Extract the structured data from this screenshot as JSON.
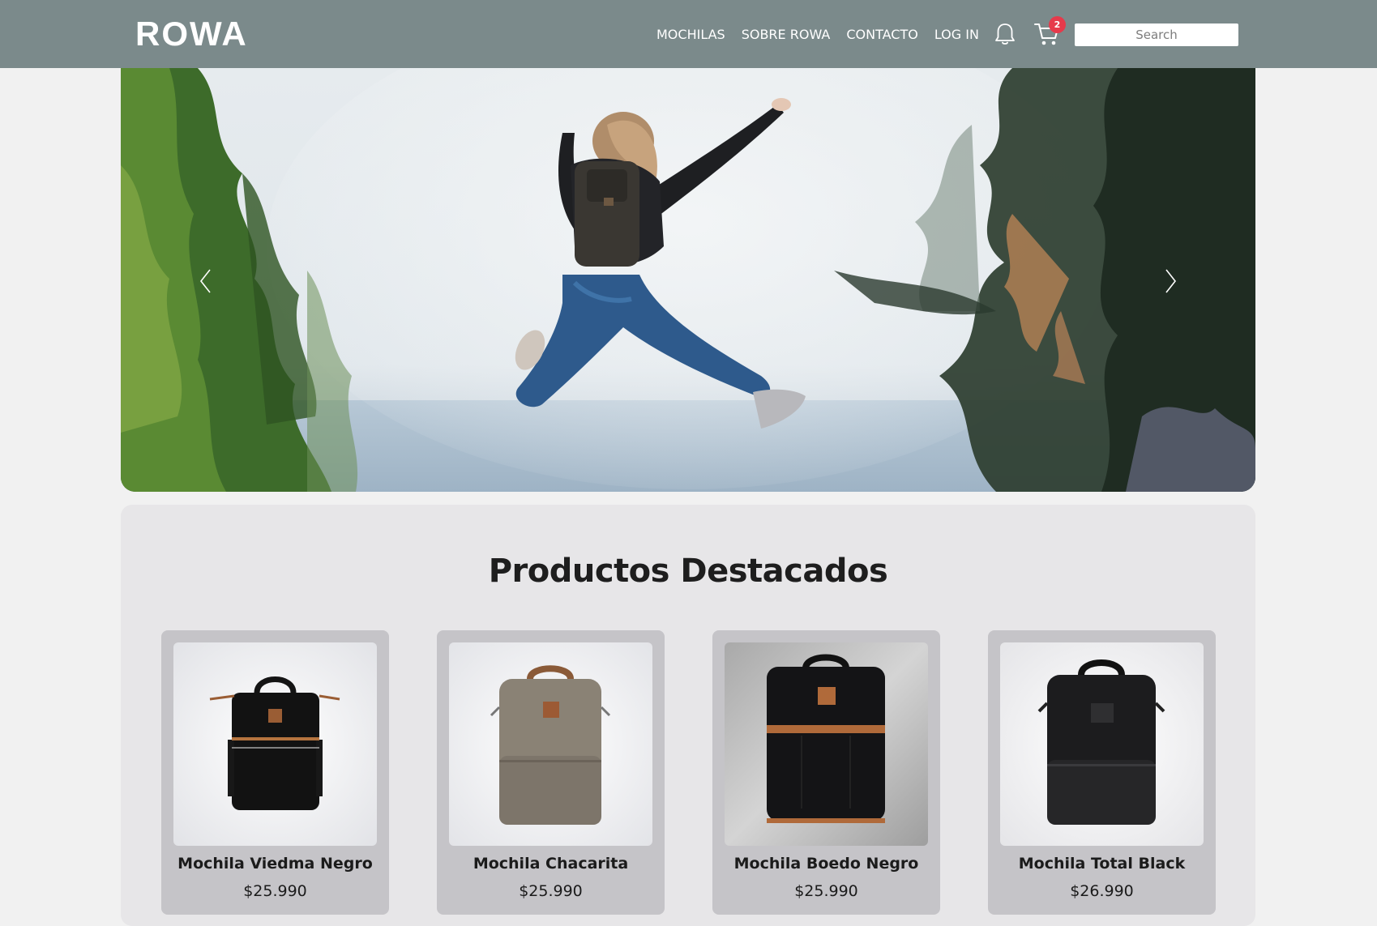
{
  "header": {
    "logo_text": "ROWA",
    "nav": [
      "MOCHILAS",
      "SOBRE ROWA",
      "CONTACTO",
      "LOG IN"
    ],
    "notification_icon": "bell-icon",
    "cart_icon": "cart-icon",
    "cart_count": "2",
    "search_placeholder": "Search"
  },
  "hero": {
    "prev_icon": "chevron-left-icon",
    "next_icon": "chevron-right-icon"
  },
  "featured": {
    "title": "Productos Destacados",
    "products": [
      {
        "name": "Mochila Viedma Negro",
        "price": "$25.990"
      },
      {
        "name": "Mochila Chacarita",
        "price": "$25.990"
      },
      {
        "name": "Mochila Boedo Negro",
        "price": "$25.990"
      },
      {
        "name": "Mochila Total Black",
        "price": "$26.990"
      }
    ]
  },
  "colors": {
    "navbar": "#7b8a8b",
    "badge": "#e63a4b",
    "card": "#c5c4c8",
    "section": "#e7e6e8"
  }
}
